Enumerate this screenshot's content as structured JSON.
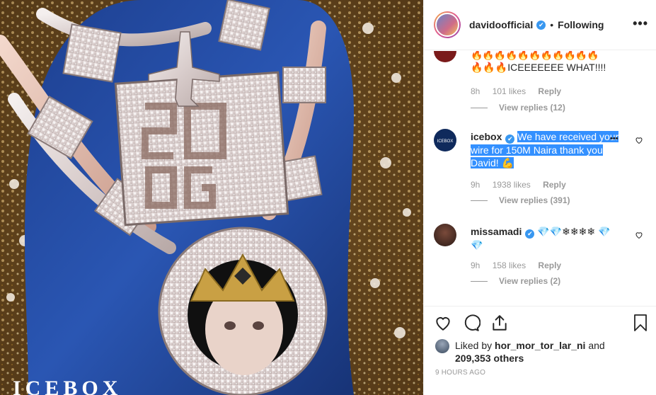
{
  "post": {
    "photo_alt": "Jewelry photo",
    "brand_watermark": "ICEBOX"
  },
  "header": {
    "username": "davidoofficial",
    "verified_mark": "✔",
    "separator": "•",
    "follow_status": "Following",
    "more_label": "•••"
  },
  "comments": [
    {
      "username": "",
      "text_parts": [
        "🔥🔥🔥🔥🔥🔥🔥🔥🔥🔥🔥",
        "🔥🔥🔥ICEEEEEEE WHAT!!!!"
      ],
      "time": "8h",
      "likes": "101 likes",
      "reply": "Reply",
      "view_replies": "View replies (12)"
    },
    {
      "username": "icebox",
      "verified_mark": "✔",
      "text": "We have received your wire for 150M Naira thank you David! 💪",
      "time": "9h",
      "likes": "1938 likes",
      "reply": "Reply",
      "view_replies": "View replies (391)",
      "more_label": "•••"
    },
    {
      "username": "missamadi",
      "verified_mark": "✔",
      "text": "💎💎❄❄❄❄ 💎💎",
      "time": "9h",
      "likes": "158 likes",
      "reply": "Reply",
      "view_replies": "View replies (2)"
    }
  ],
  "actions": {
    "icons": [
      "heart-icon",
      "comment-icon",
      "share-icon",
      "bookmark-icon"
    ]
  },
  "likes": {
    "prefix": "Liked by",
    "user": "hor_mor_tor_lar_ni",
    "conj": "and",
    "others": "209,353 others"
  },
  "time_ago": "9 HOURS AGO",
  "colors": {
    "accent_blue": "#3897f0",
    "selection": "#3390ff",
    "muted": "#999999",
    "text": "#262626"
  }
}
